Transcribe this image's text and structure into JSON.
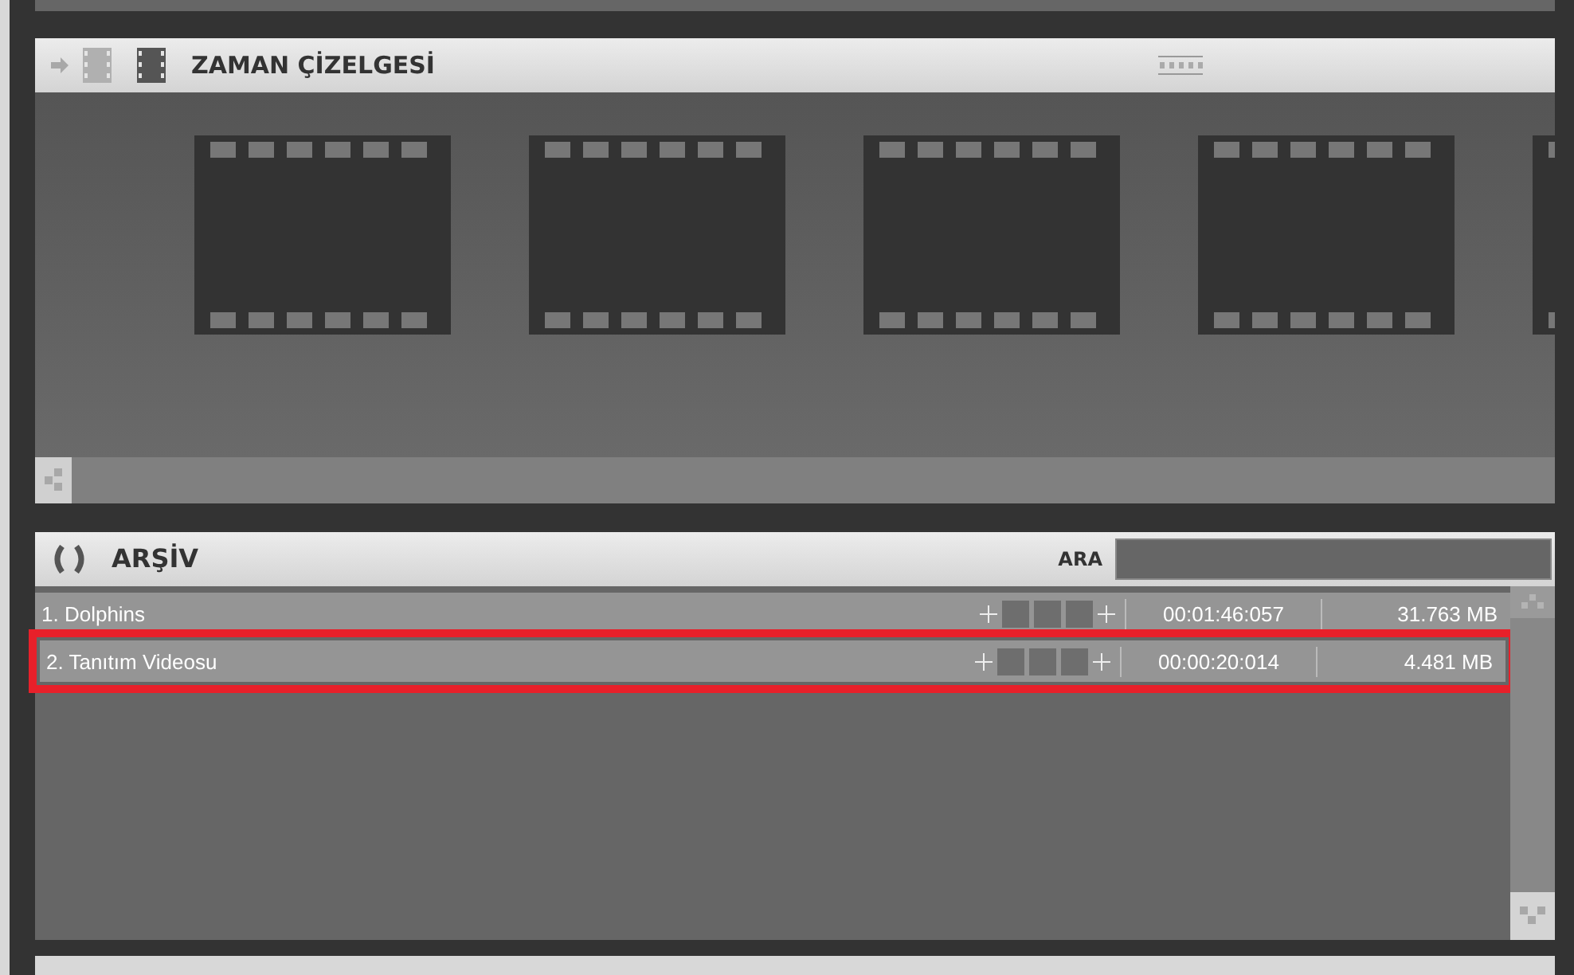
{
  "timeline": {
    "title": "ZAMAN ÇİZELGESİ"
  },
  "archive": {
    "title": "ARŞİV",
    "search_label": "ARA",
    "rows": [
      {
        "title": "1. Dolphins",
        "duration": "00:01:46:057",
        "size": "31.763 MB",
        "highlighted": false
      },
      {
        "title": "2. Tanıtım Videosu",
        "duration": "00:00:20:014",
        "size": "4.481 MB",
        "highlighted": true
      }
    ]
  }
}
